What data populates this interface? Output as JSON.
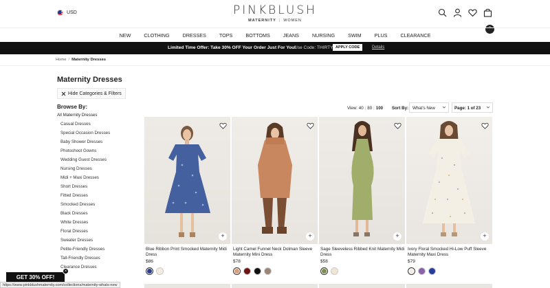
{
  "header": {
    "currency": "USD",
    "logo_main": "PINKBLUSH",
    "logo_sub_left": "MATERNITY",
    "logo_sub_sep": "|",
    "logo_sub_right": "WOMEN",
    "cart_count": "0"
  },
  "nav": [
    "NEW",
    "CLOTHING",
    "DRESSES",
    "TOPS",
    "BOTTOMS",
    "JEANS",
    "NURSING",
    "SWIM",
    "PLUS",
    "CLEARANCE"
  ],
  "promo": {
    "message": "Limited Time Offer: Take 30% OFF Your Order Just For You!",
    "code_text": "Use Code: THIRTY",
    "apply_label": "APPLY CODE",
    "details_label": "Details"
  },
  "breadcrumb": {
    "home": "Home",
    "sep": "/",
    "current": "Maternity Dresses"
  },
  "page_title": "Maternity Dresses",
  "hide_filters_label": "Hide Categories & Filters",
  "sidebar": {
    "heading": "Browse By:",
    "all": "All Maternity Dresses",
    "categories": [
      "Casual Dresses",
      "Special Occasion Dresses",
      "Baby Shower Dresses",
      "Photoshoot Gowns",
      "Wedding Guest Dresses",
      "Nursing Dresses",
      "Midi + Maxi Dresses",
      "Short Dresses",
      "Fitted Dresses",
      "Smocked Dresses",
      "Black Dresses",
      "White Dresses",
      "Floral Dresses",
      "Sweater Dresses",
      "Petite-Friendly Dresses",
      "Tall-Friendly Dresses",
      "Clearance Dresses"
    ]
  },
  "toolbar": {
    "view_label": "View:",
    "view_40": "40",
    "view_80": "80",
    "view_100": "100",
    "sort_label": "Sort By:",
    "sort_value": "What's New",
    "page_value": "Page: 1 of 23"
  },
  "products": [
    {
      "name": "Blue Ribbon Print Smocked Maternity Midi Dress",
      "price": "$86",
      "swatches": [
        "#2a3d8f",
        "#f4ece0"
      ]
    },
    {
      "name": "Light Camel Funnel Neck Dolman Sleeve Maternity Mini Dress",
      "price": "$78",
      "swatches": [
        "#d7a07a",
        "#6e1616",
        "#111111",
        "#9a8576"
      ]
    },
    {
      "name": "Sage Sleeveless Ribbed Knit Maternity Midi Dress",
      "price": "$58",
      "swatches": [
        "#7f8f4e",
        "#efe6d4"
      ]
    },
    {
      "name": "Ivory Floral Smocked Hi-Low Puff Sleeve Maternity Maxi Dress",
      "price": "$79",
      "swatches": [
        "#f3efe4",
        "#8a62a8",
        "#2a3d9f"
      ]
    }
  ],
  "overlay": {
    "promo_tab": "GET 30% OFF!",
    "close": "×",
    "status_url": "https://www.pinkblushmaternity.com/collections/maternity-whats-new"
  }
}
